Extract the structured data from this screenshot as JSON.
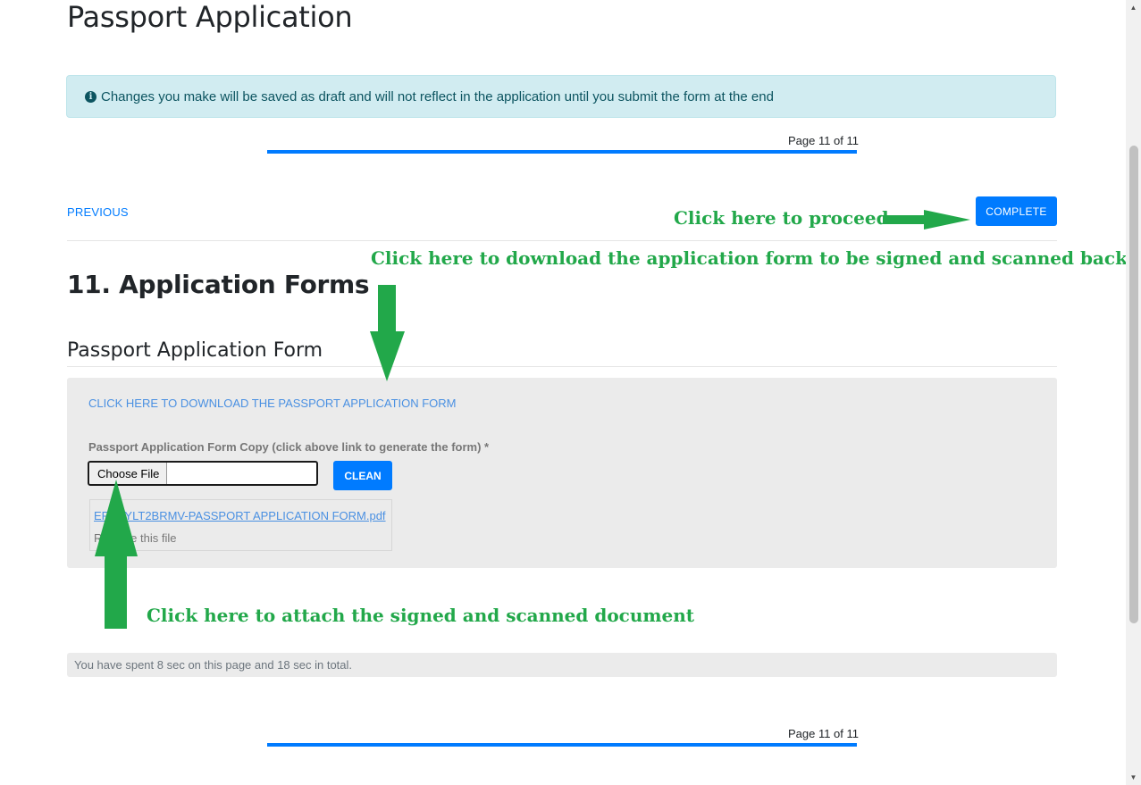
{
  "page": {
    "title": "Passport Application"
  },
  "alert": {
    "icon": "info-icon",
    "text": "Changes you make will be saved as draft and will not reflect in the application until you submit the form at the end"
  },
  "pagination": {
    "label": "Page 11 of 11",
    "progress": 1.0
  },
  "nav": {
    "previous_label": "PREVIOUS",
    "complete_label": "COMPLETE"
  },
  "section": {
    "title": "11. Application Forms",
    "subtitle": "Passport Application Form"
  },
  "form": {
    "download_link": "CLICK HERE TO DOWNLOAD THE PASSPORT APPLICATION FORM",
    "field_label": "Passport Application Form Copy (click above link to generate the form) *",
    "choose_file_label": "Choose File",
    "clean_label": "CLEAN",
    "uploaded_file": "ERAAYLT2BRMV-PASSPORT APPLICATION FORM.pdf",
    "remove_file": "Remove this file"
  },
  "time_spent": "You have spent 8 sec on this page and 18 sec in total.",
  "annotations": {
    "proceed": "Click here to proceed",
    "download": "Click here to download the application form to be signed and scanned back",
    "attach": "Click here to attach the signed and scanned document"
  },
  "colors": {
    "primary": "#007bff",
    "annotation": "#22a84a",
    "alert_bg": "#d1ecf1"
  }
}
